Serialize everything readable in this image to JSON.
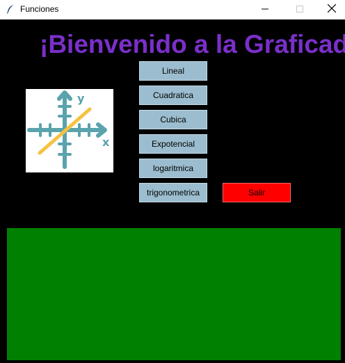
{
  "window": {
    "title": "Funciones"
  },
  "header": {
    "title": "¡Bienvenido a la Graficadora de Funciones"
  },
  "buttons": {
    "items": [
      {
        "label": "Lineal"
      },
      {
        "label": "Cuadratica"
      },
      {
        "label": "Cubica"
      },
      {
        "label": "Expotencial"
      },
      {
        "label": "logaritmica"
      },
      {
        "label": "trigonometrica"
      }
    ],
    "exit_label": "Salir"
  },
  "logo": {
    "icon": "axes-graph-icon",
    "x_axis_letter": "x",
    "y_axis_letter": "y"
  },
  "colors": {
    "background": "#000000",
    "title": "#7a2fc9",
    "function_button": "#9bbdcf",
    "exit_button": "#ff0000",
    "plot_area": "#008000"
  }
}
